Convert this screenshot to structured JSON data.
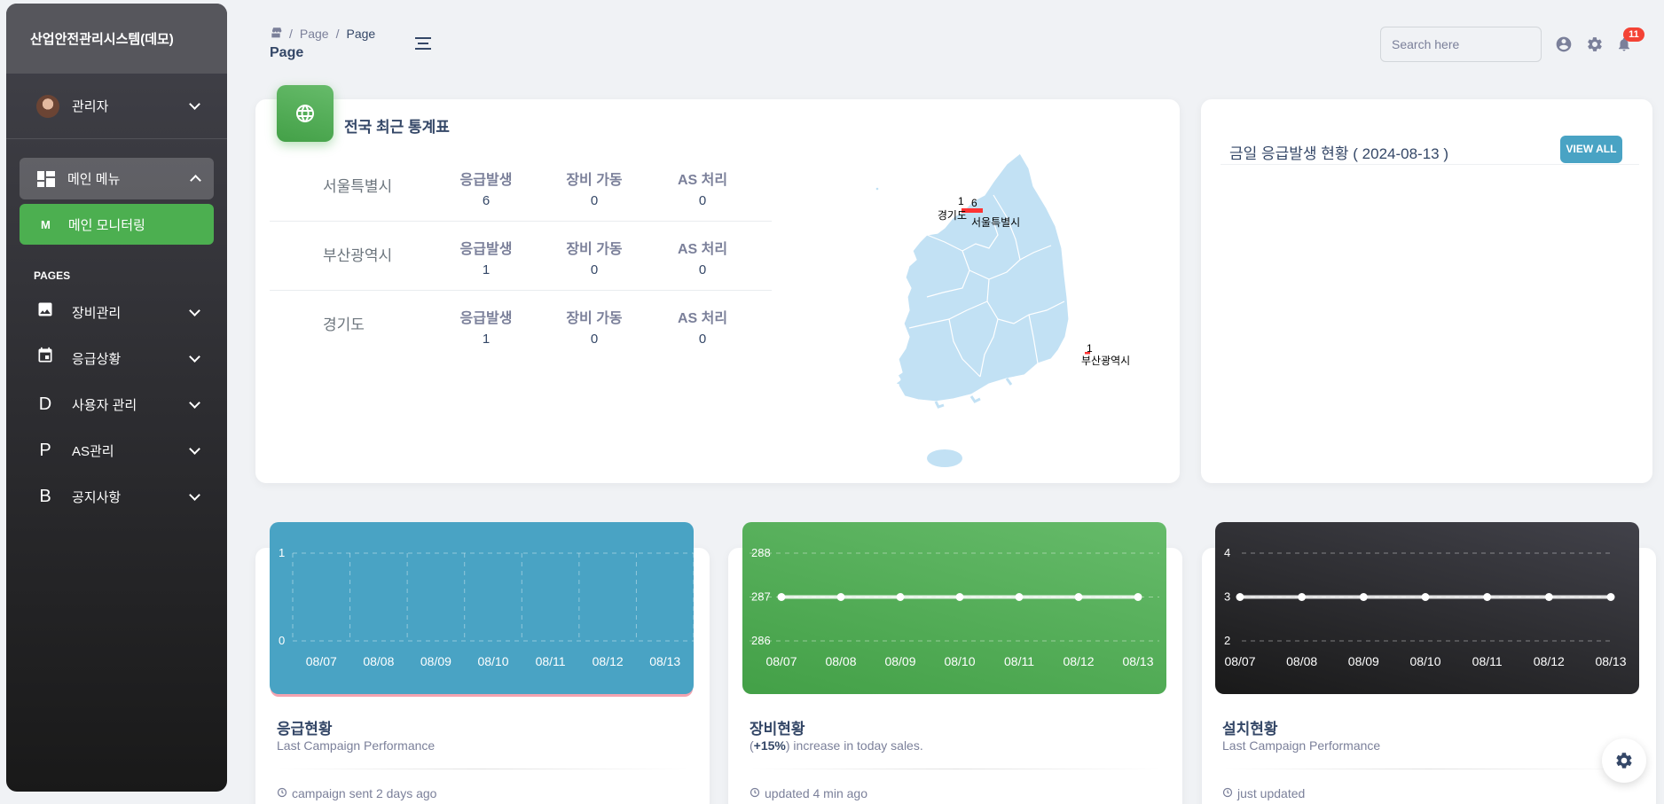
{
  "sidebar": {
    "brand": "산업안전관리시스템(데모)",
    "user_name": "관리자",
    "main_menu": "메인 메뉴",
    "main_monitoring": {
      "letter": "M",
      "label": "메인 모니터링"
    },
    "pages_title": "PAGES",
    "items": [
      {
        "icon": "image-icon",
        "glyph": "",
        "label": "장비관리"
      },
      {
        "icon": "calendar-icon",
        "glyph": "",
        "label": "응급상황"
      },
      {
        "icon": "letter-d-icon",
        "glyph": "D",
        "label": "사용자 관리"
      },
      {
        "icon": "letter-p-icon",
        "glyph": "P",
        "label": "AS관리"
      },
      {
        "icon": "letter-b-icon",
        "glyph": "B",
        "label": "공지사항"
      }
    ]
  },
  "header": {
    "breadcrumb": [
      "Page",
      "Page"
    ],
    "title": "Page",
    "search_placeholder": "Search here",
    "notification_count": "11"
  },
  "stats": {
    "title": "전국 최근 통계표",
    "rows": [
      {
        "city": "서울특별시",
        "cols": [
          {
            "h": "응급발생",
            "v": "6"
          },
          {
            "h": "장비 가동",
            "v": "0"
          },
          {
            "h": "AS 처리",
            "v": "0"
          }
        ]
      },
      {
        "city": "부산광역시",
        "cols": [
          {
            "h": "응급발생",
            "v": "1"
          },
          {
            "h": "장비 가동",
            "v": "0"
          },
          {
            "h": "AS 처리",
            "v": "0"
          }
        ]
      },
      {
        "city": "경기도",
        "cols": [
          {
            "h": "응급발생",
            "v": "1"
          },
          {
            "h": "장비 가동",
            "v": "0"
          },
          {
            "h": "AS 처리",
            "v": "0"
          }
        ]
      }
    ],
    "map_labels": {
      "seoul_value": "6",
      "seoul_name": "서울특별시",
      "gyeonggi_value": "1",
      "gyeonggi_name": "경기도",
      "busan_value": "1",
      "busan_name": "부산광역시"
    }
  },
  "emergency_today": {
    "title": "금일 응급발생 현황 ( 2024-08-13 )",
    "view_all": "VIEW ALL"
  },
  "cards": [
    {
      "title": "응급현황",
      "subtitle": "Last Campaign Performance",
      "footer": "campaign sent 2 days ago",
      "color": "#49a3c4"
    },
    {
      "title": "장비현황",
      "subtitle_strong": "+15%",
      "subtitle_rest": ") increase in today sales.",
      "subtitle_open": "(",
      "footer": "updated 4 min ago",
      "color": "#4caf50"
    },
    {
      "title": "설치현황",
      "subtitle": "Last Campaign Performance",
      "footer": "just updated",
      "color": "#1f1f1f"
    }
  ],
  "chart_data": [
    {
      "type": "bar",
      "categories": [
        "08/07",
        "08/08",
        "08/09",
        "08/10",
        "08/11",
        "08/12",
        "08/13"
      ],
      "values": [
        0,
        0,
        0,
        0,
        0,
        0,
        0
      ],
      "yticks": [
        0,
        1
      ],
      "ylim": [
        0,
        1
      ]
    },
    {
      "type": "line",
      "categories": [
        "08/07",
        "08/08",
        "08/09",
        "08/10",
        "08/11",
        "08/12",
        "08/13"
      ],
      "values": [
        287,
        287,
        287,
        287,
        287,
        287,
        287
      ],
      "yticks": [
        286,
        287,
        288
      ],
      "ylim": [
        286,
        288
      ]
    },
    {
      "type": "line",
      "categories": [
        "08/07",
        "08/08",
        "08/09",
        "08/10",
        "08/11",
        "08/12",
        "08/13"
      ],
      "values": [
        3,
        3,
        3,
        3,
        3,
        3,
        3
      ],
      "yticks": [
        2,
        3,
        4
      ],
      "ylim": [
        2,
        4
      ]
    }
  ]
}
